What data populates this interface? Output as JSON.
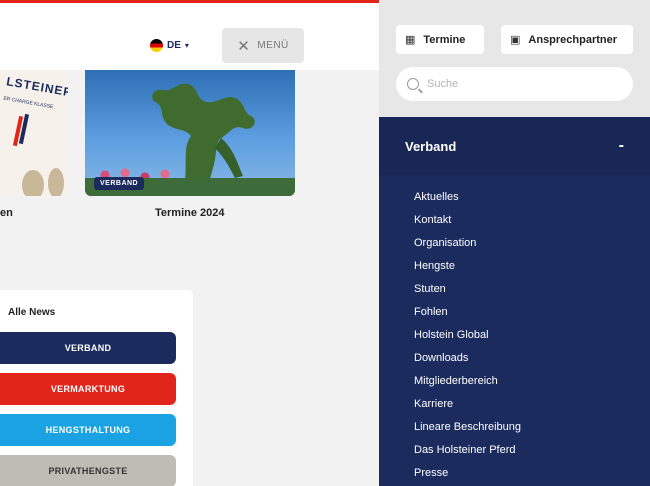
{
  "header": {
    "language": "DE",
    "menu_label": "MENÜ"
  },
  "cards": [
    {
      "partial_title": "en",
      "logo_text": "LSTEINER",
      "logo_sub": "ER CHARGE KLASSE"
    },
    {
      "badge": "VERBAND",
      "title": "Termine 2024"
    }
  ],
  "news": {
    "title": "Alle News",
    "categories": [
      {
        "label": "VERBAND",
        "color": "#1b2b5e"
      },
      {
        "label": "VERMARKTUNG",
        "color": "#e2251b"
      },
      {
        "label": "HENGSTHALTUNG",
        "color": "#1aa2e3"
      },
      {
        "label": "PRIVATHENGSTE",
        "color": "#bdbcb5"
      }
    ]
  },
  "panel": {
    "termine_label": "Termine",
    "termine_icon": "calendar-icon",
    "ansprech_label": "Ansprechpartner",
    "ansprech_icon": "contact-card-icon",
    "search_placeholder": "Suche",
    "section_title": "Verband",
    "section_toggle": "-",
    "items": [
      "Aktuelles",
      "Kontakt",
      "Organisation",
      "Hengste",
      "Stuten",
      "Fohlen",
      "Holstein Global",
      "Downloads",
      "Mitgliederbereich",
      "Karriere",
      "Lineare Beschreibung",
      "Das Holsteiner Pferd",
      "Presse"
    ]
  }
}
